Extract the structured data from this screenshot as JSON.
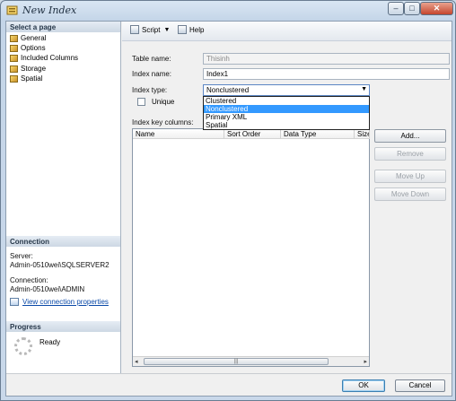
{
  "window": {
    "title": "New Index"
  },
  "left_pane": {
    "select_page_header": "Select a page",
    "pages": [
      "General",
      "Options",
      "Included Columns",
      "Storage",
      "Spatial"
    ],
    "connection_header": "Connection",
    "server_label": "Server:",
    "server_value": "Admin-0510wei\\SQLSERVER2",
    "connection_label": "Connection:",
    "connection_value": "Admin-0510wei\\ADMIN",
    "view_connection_link": "View connection properties",
    "progress_header": "Progress",
    "progress_status": "Ready"
  },
  "toolbar": {
    "script_label": "Script",
    "help_label": "Help"
  },
  "form": {
    "table_name_label": "Table name:",
    "table_name_value": "Thisinh",
    "index_name_label": "Index name:",
    "index_name_value": "Index1",
    "index_type_label": "Index type:",
    "index_type_value": "Nonclustered",
    "index_type_options": [
      "Clustered",
      "Nonclustered",
      "Primary XML",
      "Spatial"
    ],
    "unique_label": "Unique",
    "key_columns_label": "Index key columns:"
  },
  "grid": {
    "columns": [
      "Name",
      "Sort Order",
      "Data Type",
      "Size"
    ]
  },
  "side_buttons": {
    "add": "Add...",
    "remove": "Remove",
    "move_up": "Move Up",
    "move_down": "Move Down"
  },
  "footer": {
    "ok": "OK",
    "cancel": "Cancel"
  }
}
